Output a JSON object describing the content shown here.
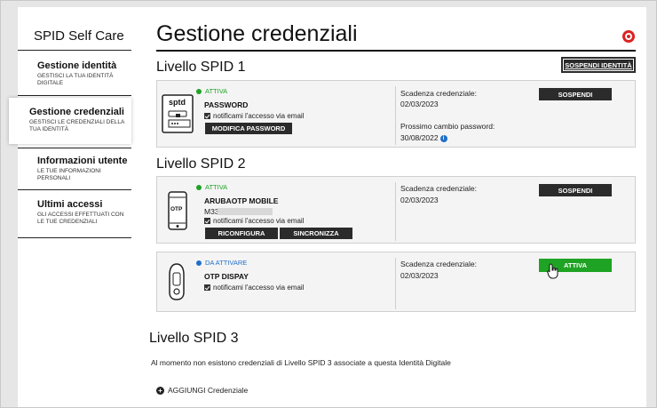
{
  "sidebar": {
    "brand": "SPID Self Care",
    "items": [
      {
        "title": "Gestione identità",
        "subtitle": "GESTISCI LA TUA IDENTITÀ DIGITALE"
      },
      {
        "title": "Gestione credenziali",
        "subtitle": "GESTISCI LE CREDENZIALI DELLA TUA IDENTITÀ"
      },
      {
        "title": "Informazioni utente",
        "subtitle": "LE TUE INFORMAZIONI PERSONALI"
      },
      {
        "title": "Ultimi accessi",
        "subtitle": "GLI ACCESSI EFFETTUATI CON LE TUE CREDENZIALI"
      }
    ]
  },
  "main": {
    "title": "Gestione credenziali",
    "suspend_identity": "SOSPENDI IDENTITÀ",
    "level1": {
      "title": "Livello SPID 1",
      "card": {
        "status": "ATTIVA",
        "name": "PASSWORD",
        "notify": "notificami l'accesso via email",
        "button": "MODIFICA PASSWORD",
        "exp_label": "Scadenza credenziale:",
        "exp_value": "02/03/2023",
        "next_label": "Prossimo cambio password:",
        "next_value": "30/08/2022",
        "action": "SOSPENDI",
        "icon_text": "sptd"
      }
    },
    "level2": {
      "title": "Livello SPID 2",
      "cards": [
        {
          "status": "ATTIVA",
          "name": "ARUBAOTP MOBILE",
          "serial": "M33",
          "notify": "notificami l'accesso via email",
          "buttons": [
            "RICONFIGURA",
            "SINCRONIZZA"
          ],
          "exp_label": "Scadenza credenziale:",
          "exp_value": "02/03/2023",
          "action": "SOSPENDI",
          "icon_text": "OTP"
        },
        {
          "status": "DA ATTIVARE",
          "name": "OTP DISPAY",
          "notify": "notificami l'accesso via email",
          "exp_label": "Scadenza credenziale:",
          "exp_value": "02/03/2023",
          "action": "ATTIVA"
        }
      ]
    },
    "level3": {
      "title": "Livello SPID 3",
      "message": "Al momento non esistono credenziali di Livello SPID 3 associate a questa Identità Digitale",
      "add": "AGGIUNGI Credenziale"
    }
  },
  "colors": {
    "status_active": "#1fa324",
    "status_pending": "#1f6fc9",
    "accent_green": "#1fa324",
    "dark_button": "#2b2b2b",
    "help_icon": "#dd2222"
  }
}
